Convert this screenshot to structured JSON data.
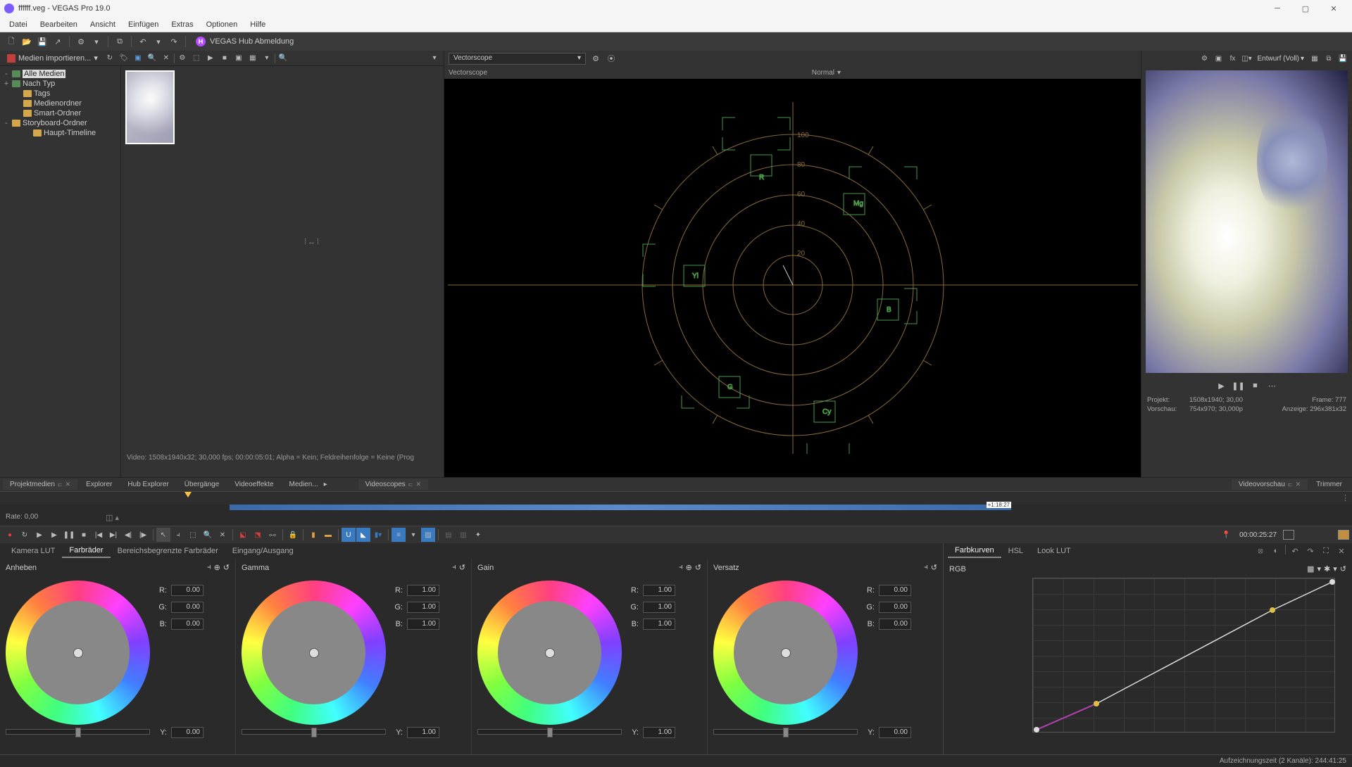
{
  "titlebar": {
    "title": "ffffff.veg - VEGAS Pro 19.0"
  },
  "menu": [
    "Datei",
    "Bearbeiten",
    "Ansicht",
    "Einfügen",
    "Extras",
    "Optionen",
    "Hilfe"
  ],
  "hub": {
    "label": "VEGAS Hub Abmeldung",
    "icon_letter": "H"
  },
  "media_toolbar": {
    "import_label": "Medien importieren..."
  },
  "tree": {
    "items": [
      {
        "label": "Alle Medien",
        "selected": true,
        "folder": "green",
        "exp": "-",
        "indent": 0
      },
      {
        "label": "Nach Typ",
        "folder": "green",
        "exp": "+",
        "indent": 0
      },
      {
        "label": "Tags",
        "folder": "yellow",
        "exp": "",
        "indent": 1
      },
      {
        "label": "Medienordner",
        "folder": "yellow",
        "exp": "",
        "indent": 1
      },
      {
        "label": "Smart-Ordner",
        "folder": "yellow",
        "exp": "",
        "indent": 1
      },
      {
        "label": "Storyboard-Ordner",
        "folder": "yellow",
        "exp": "-",
        "indent": 0
      },
      {
        "label": "Haupt-Timeline",
        "folder": "yellow",
        "exp": "",
        "indent": 2
      }
    ]
  },
  "video_info": "Video: 1508x1940x32; 30,000 fps; 00:00:05:01; Alpha = Kein; Feldreihenfolge = Keine (Prog",
  "scope": {
    "dropdown": "Vectorscope",
    "sub_label": "Vectorscope",
    "normal": "Normal",
    "ticks": [
      "100",
      "80",
      "60",
      "40",
      "20"
    ],
    "targets": [
      "R",
      "Mg",
      "B",
      "Cy",
      "G",
      "Yl"
    ]
  },
  "preview": {
    "quality_label": "Entwurf (Voll)",
    "info": {
      "projekt_k": "Projekt:",
      "projekt_v": "1508x1940;  30,00",
      "frame_k": "Frame:",
      "frame_v": "777",
      "vorschau_k": "Vorschau:",
      "vorschau_v": "754x970;  30,000p",
      "anzeige_k": "Anzeige:",
      "anzeige_v": "296x381x32"
    }
  },
  "tabs_left": [
    {
      "label": "Projektmedien",
      "pin": true,
      "close": true,
      "active": true
    },
    {
      "label": "Explorer"
    },
    {
      "label": "Hub Explorer"
    },
    {
      "label": "Übergänge"
    },
    {
      "label": "Videoeffekte"
    },
    {
      "label": "Medien..."
    }
  ],
  "tabs_mid": [
    {
      "label": "Videoscopes",
      "pin": true,
      "close": true,
      "active": true
    }
  ],
  "tabs_right": [
    {
      "label": "Videovorschau",
      "pin": true,
      "close": true,
      "active": true
    },
    {
      "label": "Trimmer"
    }
  ],
  "timeline": {
    "rate_label": "Rate: 0,00",
    "marker": "+1:18:27",
    "timecode": "00:00:25:27"
  },
  "cg_tabs_left": [
    "Kamera LUT",
    "Farbräder",
    "Bereichsbegrenzte Farbräder",
    "Eingang/Ausgang"
  ],
  "cg_tabs_left_active": 1,
  "cg_tabs_right": [
    "Farbkurven",
    "HSL",
    "Look LUT"
  ],
  "cg_tabs_right_active": 0,
  "wheels": [
    {
      "title": "Anheben",
      "r": "0.00",
      "g": "0.00",
      "b": "0.00",
      "y": "0.00"
    },
    {
      "title": "Gamma",
      "r": "1.00",
      "g": "1.00",
      "b": "1.00",
      "y": "1.00"
    },
    {
      "title": "Gain",
      "r": "1.00",
      "g": "1.00",
      "b": "1.00",
      "y": "1.00"
    },
    {
      "title": "Versatz",
      "r": "0.00",
      "g": "0.00",
      "b": "0.00",
      "y": "0.00"
    }
  ],
  "rgb_labels": {
    "r": "R:",
    "g": "G:",
    "b": "B:",
    "y": "Y:"
  },
  "curves": {
    "channel": "RGB"
  },
  "status": {
    "rec_time": "Aufzeichnungszeit (2 Kanäle): 244:41:25"
  }
}
